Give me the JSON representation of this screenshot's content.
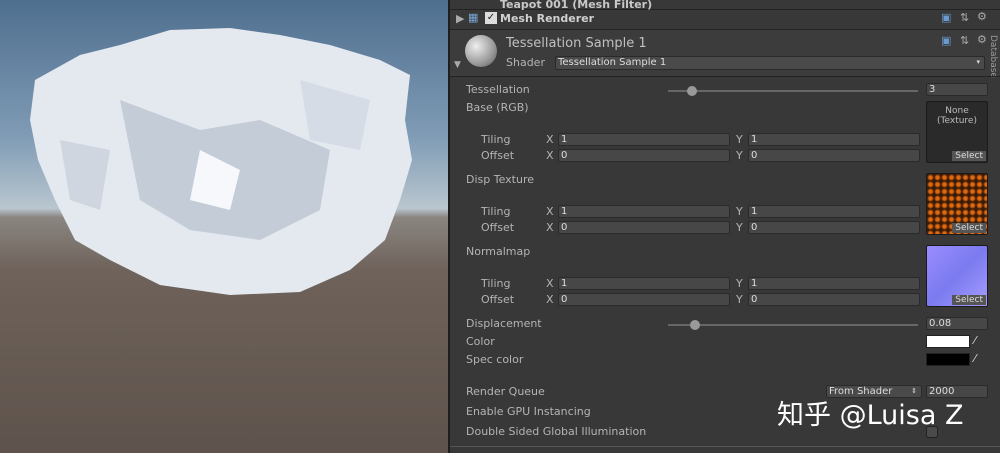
{
  "components": {
    "mesh_filter": "Teapot 001 (Mesh Filter)",
    "mesh_renderer": "Mesh Renderer"
  },
  "material": {
    "name": "Tessellation Sample 1",
    "shader_label": "Shader",
    "shader_value": "Tessellation Sample 1"
  },
  "side_tab": "Database",
  "props": {
    "tessellation": {
      "label": "Tessellation",
      "value": "3",
      "fraction": 0.08
    },
    "base": {
      "label": "Base (RGB)",
      "tex": "None\n(Texture)",
      "tiling_x": "1",
      "tiling_y": "1",
      "offset_x": "0",
      "offset_y": "0"
    },
    "disp": {
      "label": "Disp Texture",
      "tiling_x": "1",
      "tiling_y": "1",
      "offset_x": "0",
      "offset_y": "0"
    },
    "normal": {
      "label": "Normalmap",
      "tiling_x": "1",
      "tiling_y": "1",
      "offset_x": "0",
      "offset_y": "0"
    },
    "displacement": {
      "label": "Displacement",
      "value": "0.08",
      "fraction": 0.09
    },
    "color": {
      "label": "Color",
      "hex": "#ffffff"
    },
    "spec": {
      "label": "Spec color",
      "hex": "#000000"
    },
    "render_queue": {
      "label": "Render Queue",
      "mode": "From Shader",
      "value": "2000"
    },
    "gpu": {
      "label": "Enable GPU Instancing"
    },
    "dsgi": {
      "label": "Double Sided Global Illumination",
      "checked": false
    }
  },
  "common": {
    "tiling": "Tiling",
    "offset": "Offset",
    "x": "X",
    "y": "Y",
    "select": "Select"
  },
  "watermark": "知乎 @Luisa Z"
}
